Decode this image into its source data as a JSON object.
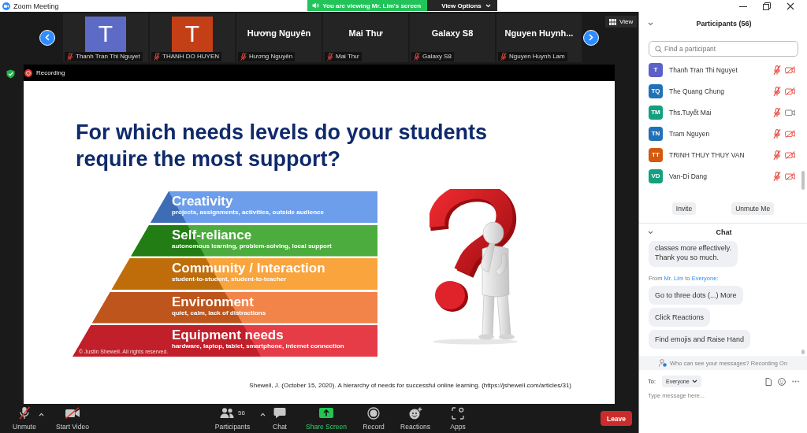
{
  "window": {
    "title": "Zoom Meeting"
  },
  "share_banner": {
    "text": "You are viewing Mr. Lim's screen",
    "view_options": "View Options"
  },
  "thumbnails": [
    {
      "kind": "avatar",
      "initial": "T",
      "color": "#5e6bc6",
      "name": "Thanh Tran Thi Nguyet",
      "muted": true
    },
    {
      "kind": "avatar",
      "initial": "T",
      "color": "#c53f16",
      "name": "THANH DO HUYEN",
      "muted": true
    },
    {
      "kind": "name",
      "display_name": "Hương Nguyên",
      "name": "Hương Nguyên",
      "muted": true
    },
    {
      "kind": "name",
      "display_name": "Mai Thư",
      "name": "Mai Thư",
      "muted": true
    },
    {
      "kind": "name",
      "display_name": "Galaxy S8",
      "name": "Galaxy S8",
      "muted": true
    },
    {
      "kind": "name",
      "display_name": "Nguyen Huynh...",
      "name": "Nguyen Huynh Lam",
      "muted": true
    }
  ],
  "view_button": "View",
  "recording": {
    "label": "Recording"
  },
  "slide": {
    "title": "For which needs levels do your students require the most support?",
    "pyramid": [
      {
        "title": "Creativity",
        "subtitle": "projects, assignments, activities, outside audience",
        "color": "#6d9eeb"
      },
      {
        "title": "Self-reliance",
        "subtitle": "autonomous learning, problem-solving, local support",
        "color": "#4cad3e"
      },
      {
        "title": "Community / Interaction",
        "subtitle": "student-to-student, student-to-teacher",
        "color": "#f9a43c"
      },
      {
        "title": "Environment",
        "subtitle": "quiet, calm, lack of distractions",
        "color": "#f2844a"
      },
      {
        "title": "Equipment needs",
        "subtitle": "hardware, laptop, tablet, smartphone, internet connection",
        "color": "#e63c48"
      }
    ],
    "copyright": "© Justin Shewell. All rights reserved.",
    "citation": "Shewell, J. (October 15, 2020). A hierarchy of needs for successful online learning. (https://jshewell.com/articles/31)"
  },
  "toolbar": [
    {
      "kind": "mic",
      "label": "Unmute",
      "off": true,
      "menu": true
    },
    {
      "kind": "video",
      "label": "Start Video",
      "off": true,
      "menu": false
    },
    {
      "kind": "participants",
      "label": "Participants",
      "count": "56",
      "menu": true
    },
    {
      "kind": "chat",
      "label": "Chat",
      "menu": false
    },
    {
      "kind": "share",
      "label": "Share Screen",
      "menu": false
    },
    {
      "kind": "record",
      "label": "Record",
      "menu": false
    },
    {
      "kind": "reactions",
      "label": "Reactions",
      "menu": false
    },
    {
      "kind": "apps",
      "label": "Apps",
      "menu": false
    }
  ],
  "leave_button": "Leave",
  "participants_panel": {
    "title": "Participants (56)",
    "search_placeholder": "Find a participant",
    "participants": [
      {
        "initials": "T",
        "name": "Thanh Tran Thi Nguyet",
        "color": "#5d60c8",
        "muted": true,
        "video_on": false
      },
      {
        "initials": "TQ",
        "name": "The Quang Chung",
        "color": "#2271b8",
        "muted": true,
        "video_on": false
      },
      {
        "initials": "TM",
        "name": "Ths.Tuyết Mai",
        "color": "#13a07f",
        "muted": true,
        "video_on": true
      },
      {
        "initials": "TN",
        "name": "Tram Nguyen",
        "color": "#2271b8",
        "muted": true,
        "video_on": false
      },
      {
        "initials": "TT",
        "name": "TRINH THUY THUY VAN",
        "color": "#d4580f",
        "muted": true,
        "video_on": false
      },
      {
        "initials": "VD",
        "name": "Van-Di Dang",
        "color": "#14a07e",
        "muted": true,
        "video_on": false
      }
    ],
    "buttons": [
      "Invite",
      "Unmute Me"
    ]
  },
  "chat": {
    "title": "Chat",
    "items": [
      {
        "kind": "bubble",
        "text": "classes more effectively.\nThank you so much."
      },
      {
        "kind": "sender",
        "from_label": "From",
        "sender": "Mr. Lim",
        "to_label": "to",
        "recipient": "Everyone",
        "suffix": ":"
      },
      {
        "kind": "bubble",
        "text": "Go to three dots (...) More"
      },
      {
        "kind": "bubble",
        "text": "Click Reactions"
      },
      {
        "kind": "bubble",
        "text": "Find emojis and Raise Hand"
      }
    ],
    "notice": "Who can see your messages? Recording On",
    "to_label": "To:",
    "recipient": "Everyone",
    "placeholder": "Type message here..."
  }
}
